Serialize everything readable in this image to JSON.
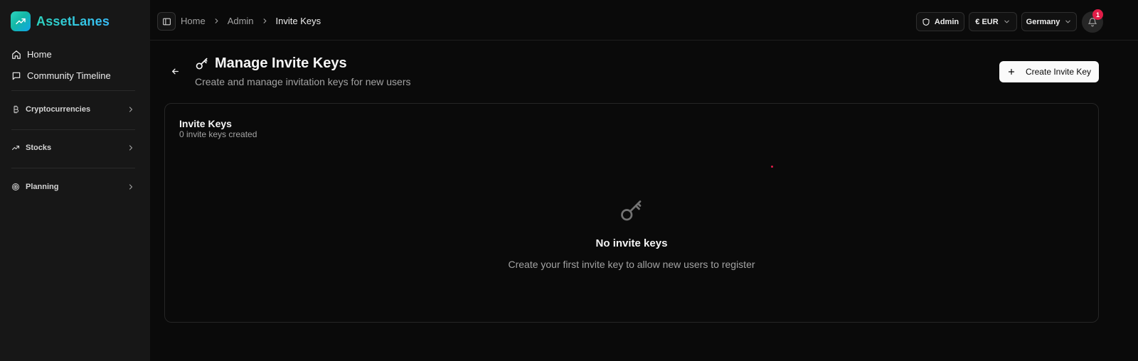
{
  "brand": {
    "name": "AssetLanes",
    "logo_icon": "trending-up-icon"
  },
  "sidebar": {
    "items": [
      {
        "label": "Home",
        "icon": "home-icon"
      },
      {
        "label": "Community Timeline",
        "icon": "message-square-icon"
      }
    ],
    "groups": [
      {
        "label": "Cryptocurrencies",
        "icon": "bitcoin-icon"
      },
      {
        "label": "Stocks",
        "icon": "trending-up-icon"
      },
      {
        "label": "Planning",
        "icon": "target-icon"
      }
    ]
  },
  "topbar": {
    "breadcrumb": [
      "Home",
      "Admin",
      "Invite Keys"
    ],
    "admin_label": "Admin",
    "currency": "€ EUR",
    "country": "Germany",
    "notification_count": "1"
  },
  "page": {
    "title": "Manage Invite Keys",
    "subtitle": "Create and manage invitation keys for new users",
    "create_button": "Create Invite Key"
  },
  "card": {
    "title": "Invite Keys",
    "count_text": "0 invite keys created",
    "empty_title": "No invite keys",
    "empty_text": "Create your first invite key to allow new users to register"
  },
  "colors": {
    "accent": "#14b8a6",
    "badge": "#e11d48",
    "background": "#0a0a0a",
    "sidebar": "#171717"
  }
}
